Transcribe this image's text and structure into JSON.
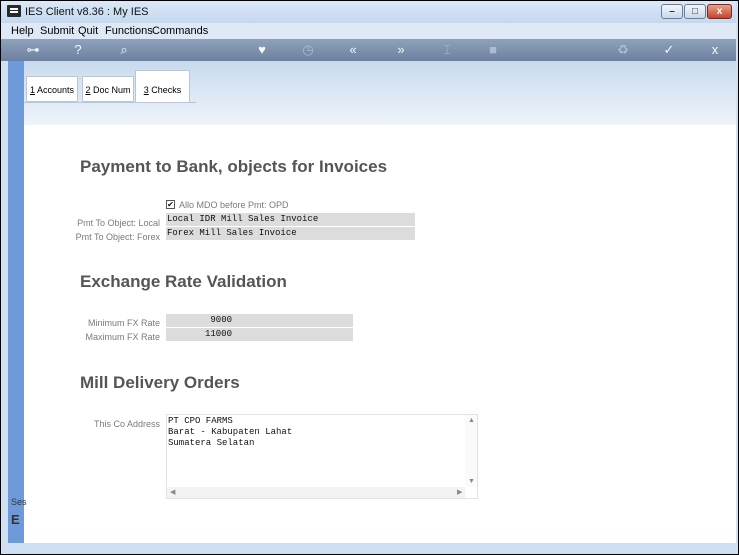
{
  "window": {
    "title": "IES Client v8.36 : My IES",
    "min": "–",
    "max": "□",
    "close": "x"
  },
  "menu": [
    "Help",
    "Submit",
    "Quit",
    "Functions",
    "Commands"
  ],
  "toolbar": {
    "icons": [
      "key-icon",
      "help-icon",
      "search-icon",
      "heart-icon",
      "clock-icon",
      "rewind-icon",
      "forward-icon",
      "text-cursor-icon",
      "stop-icon",
      "recycle-icon",
      "check-icon",
      "close-icon"
    ],
    "glyphs": [
      "⊶",
      "?",
      "⌕",
      "♥",
      "◷",
      "«",
      "»",
      "⌶",
      "■",
      "♻",
      "✓",
      "x"
    ]
  },
  "tabs": [
    {
      "key": "1",
      "label": " Accounts"
    },
    {
      "key": "2",
      "label": " Doc Num"
    },
    {
      "key": "3",
      "label": " Checks"
    }
  ],
  "sections": {
    "payment": "Payment to Bank, objects for Invoices",
    "exchange": "Exchange Rate Validation",
    "mill": "Mill Delivery Orders"
  },
  "payment": {
    "checkbox_label": "Allo MDO before Pmt: OPD",
    "checked_glyph": "✔",
    "local_label": "Pmt To Object: Local",
    "local_value": "Local IDR Mill Sales Invoice",
    "forex_label": "Pmt To Object: Forex",
    "forex_value": "Forex Mill Sales Invoice"
  },
  "exchange": {
    "min_label": "Minimum FX Rate",
    "min_value": "9000",
    "max_label": "Maximum FX Rate",
    "max_value": "11000"
  },
  "mill": {
    "address_label": "This Co Address",
    "address_lines": [
      "PT CPO FARMS",
      "Barat - Kabupaten Lahat",
      "Sumatera Selatan"
    ]
  },
  "side": {
    "top": "Ses",
    "bottom": "E"
  }
}
